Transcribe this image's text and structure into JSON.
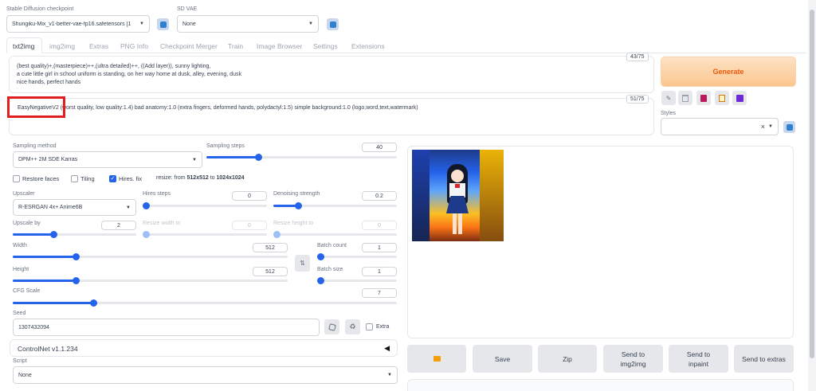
{
  "header": {
    "checkpoint_label": "Stable Diffusion checkpoint",
    "checkpoint_value": "Shungiku-Mix_v1-better-vae-fp16.safetensors [1",
    "vae_label": "SD VAE",
    "vae_value": "None"
  },
  "tabs": [
    "txt2img",
    "img2img",
    "Extras",
    "PNG Info",
    "Checkpoint Merger",
    "Train",
    "Image Browser",
    "Settings",
    "Extensions"
  ],
  "prompt": {
    "line1": "(best quality)+,(masterpiece)++,(ultra detailed)++, ((Add layer)), sunny lighting,",
    "line2": "a cute little girl in school uniform is standing, on her way home at dusk, alley, evening, dusk",
    "line3": "nice hands, perfect hands",
    "token_count": "43/75"
  },
  "negative_prompt": {
    "text": "EasyNegativeV2 (worst quality, low quality:1.4) bad anatomy:1.0 (extra fingers, deformed hands, polydactyl:1.5) simple background:1.0 (logo,word,text,watermark)",
    "token_count": "51/75"
  },
  "generate_label": "Generate",
  "styles": {
    "label": "Styles",
    "clear": "×"
  },
  "sampling": {
    "method_label": "Sampling method",
    "method_value": "DPM++ 2M SDE Karras",
    "steps_label": "Sampling steps",
    "steps_value": "40",
    "steps_fraction": 0.27
  },
  "options": {
    "restore_faces": "Restore faces",
    "tiling": "Tiling",
    "hires_fix": "Hires. fix",
    "resize_prefix": "resize: from ",
    "resize_from": "512x512",
    "resize_mid": " to ",
    "resize_to": "1024x1024"
  },
  "hires": {
    "upscaler_label": "Upscaler",
    "upscaler_value": "R-ESRGAN 4x+ Anime6B",
    "steps_label": "Hires steps",
    "steps_value": "0",
    "denoise_label": "Denoising strength",
    "denoise_value": "0.2",
    "denoise_fraction": 0.2,
    "upscale_label": "Upscale by",
    "upscale_value": "2",
    "upscale_fraction": 0.33,
    "resize_w_label": "Resize width to",
    "resize_w_value": "0",
    "resize_h_label": "Resize height to",
    "resize_h_value": "0"
  },
  "dims": {
    "width_label": "Width",
    "width_value": "512",
    "width_fraction": 0.23,
    "height_label": "Height",
    "height_value": "512",
    "height_fraction": 0.23,
    "swap_icon": "⇅",
    "batch_count_label": "Batch count",
    "batch_count_value": "1",
    "batch_size_label": "Batch size",
    "batch_size_value": "1"
  },
  "cfg": {
    "label": "CFG Scale",
    "value": "7",
    "fraction": 0.21
  },
  "seed": {
    "label": "Seed",
    "value": "1307432094",
    "extra_label": "Extra"
  },
  "controlnet": {
    "label": "ControlNet v1.1.234",
    "arrow": "◀"
  },
  "script": {
    "label": "Script",
    "value": "None"
  },
  "output_buttons": {
    "folder_icon": "folder-icon",
    "save": "Save",
    "zip": "Zip",
    "send_img2img_1": "Send to",
    "send_img2img_2": "img2img",
    "send_inpaint_1": "Send to",
    "send_inpaint_2": "inpaint",
    "send_extras": "Send to extras"
  },
  "colors": {
    "accent": "#2563eb",
    "generate_top": "#fde2c4",
    "generate_bottom": "#fbc68f",
    "generate_text": "#ea580c",
    "highlight": "#e11d1d"
  }
}
